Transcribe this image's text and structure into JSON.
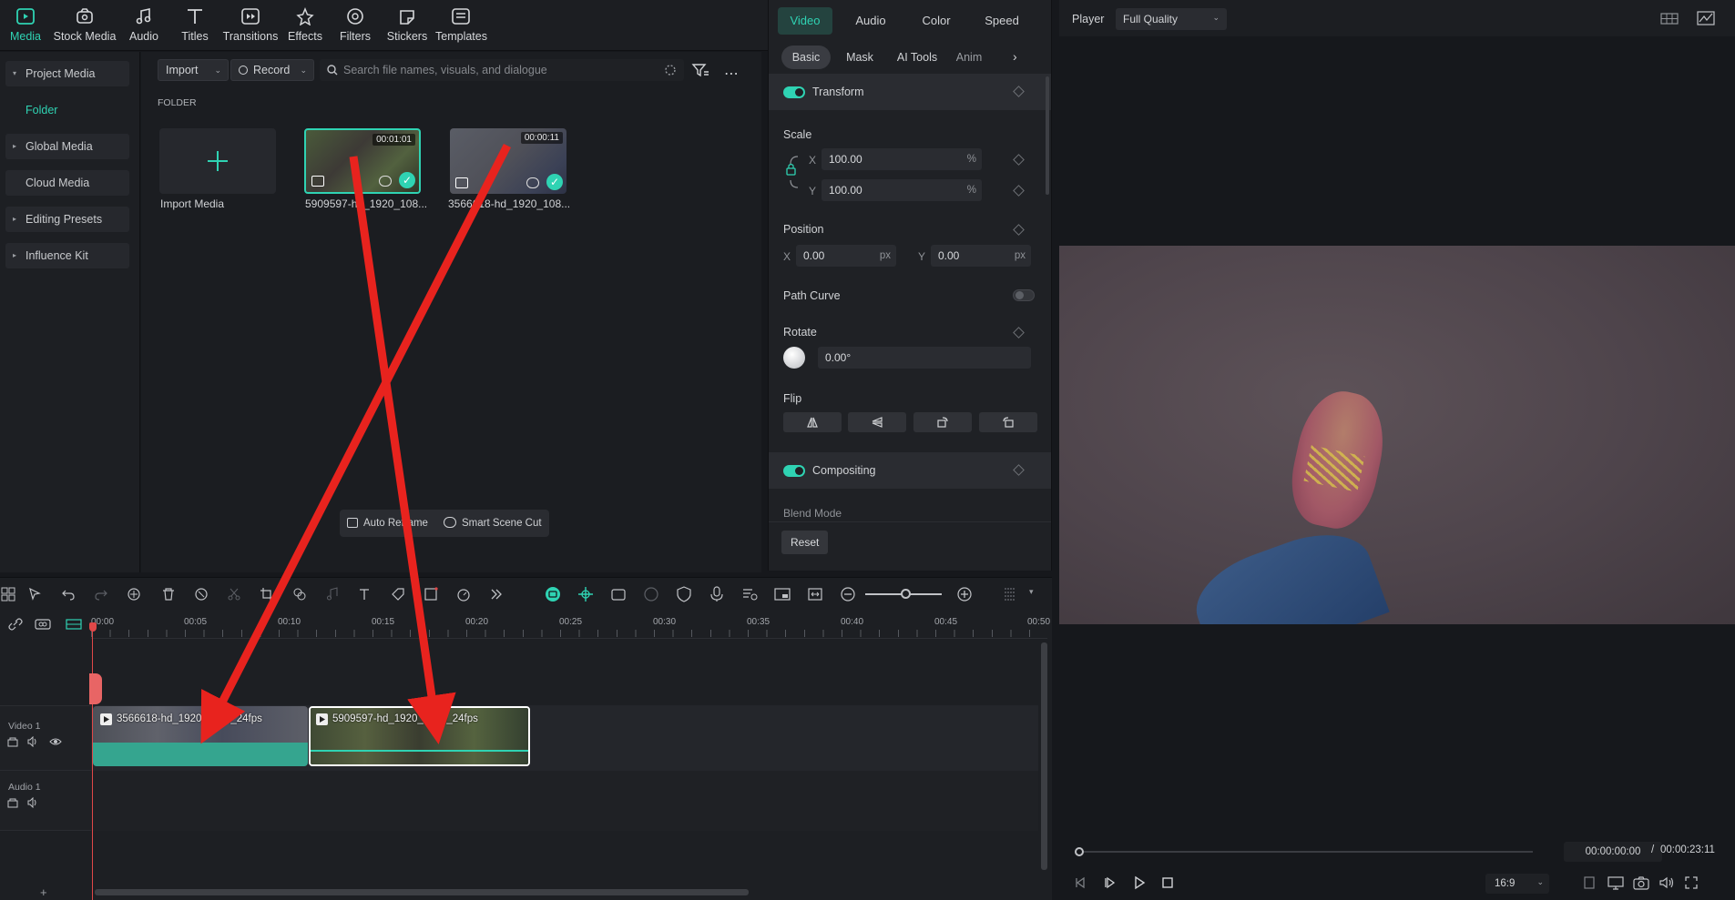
{
  "toolbar": {
    "tabs": [
      {
        "label": "Media",
        "icon": "media-icon",
        "active": true
      },
      {
        "label": "Stock Media",
        "icon": "stock-media-icon"
      },
      {
        "label": "Audio",
        "icon": "audio-icon"
      },
      {
        "label": "Titles",
        "icon": "titles-icon"
      },
      {
        "label": "Transitions",
        "icon": "transitions-icon"
      },
      {
        "label": "Effects",
        "icon": "effects-icon"
      },
      {
        "label": "Filters",
        "icon": "filters-icon"
      },
      {
        "label": "Stickers",
        "icon": "stickers-icon"
      },
      {
        "label": "Templates",
        "icon": "templates-icon"
      }
    ]
  },
  "sidebar": {
    "items": [
      {
        "label": "Project Media"
      },
      {
        "label": "Folder"
      },
      {
        "label": "Global Media"
      },
      {
        "label": "Cloud Media"
      },
      {
        "label": "Editing Presets"
      },
      {
        "label": "Influence Kit"
      }
    ]
  },
  "media": {
    "import_label": "Import",
    "record_label": "Record",
    "search_placeholder": "Search file names, visuals, and dialogue",
    "folder_heading": "FOLDER",
    "import_media_label": "Import Media",
    "items": [
      {
        "name": "5909597-hd_1920_108...",
        "duration": "00:01:01"
      },
      {
        "name": "3566618-hd_1920_108...",
        "duration": "00:00:11"
      }
    ],
    "auto_reframe_label": "Auto Reframe",
    "smart_scene_cut_label": "Smart Scene Cut"
  },
  "props": {
    "tabs": [
      "Video",
      "Audio",
      "Color",
      "Speed"
    ],
    "subtabs": [
      "Basic",
      "Mask",
      "AI Tools",
      "Anim"
    ],
    "transform_label": "Transform",
    "scale_label": "Scale",
    "scale_x": "100.00",
    "scale_y": "100.00",
    "percent_unit": "%",
    "x_axis": "X",
    "y_axis": "Y",
    "position_label": "Position",
    "pos_x": "0.00",
    "pos_y": "0.00",
    "px_unit": "px",
    "path_curve_label": "Path Curve",
    "rotate_label": "Rotate",
    "rotate_value": "0.00°",
    "flip_label": "Flip",
    "compositing_label": "Compositing",
    "blend_mode_label": "Blend Mode",
    "reset_label": "Reset"
  },
  "player": {
    "label": "Player",
    "quality": "Full Quality",
    "current_time": "00:00:00:00",
    "separator": "/",
    "total_time": "00:00:23:11",
    "aspect": "16:9"
  },
  "timeline": {
    "ruler": [
      "00:00",
      "00:05",
      "00:10",
      "00:15",
      "00:20",
      "00:25",
      "00:30",
      "00:35",
      "00:40",
      "00:45",
      "00:50"
    ],
    "video_track_label": "Video 1",
    "audio_track_label": "Audio 1",
    "clips": [
      {
        "title": "3566618-hd_1920_1080_24fps"
      },
      {
        "title": "5909597-hd_1920_1080_24fps"
      }
    ]
  },
  "colors": {
    "accent": "#2fd3b3",
    "annotation_arrow": "#e8231e"
  }
}
